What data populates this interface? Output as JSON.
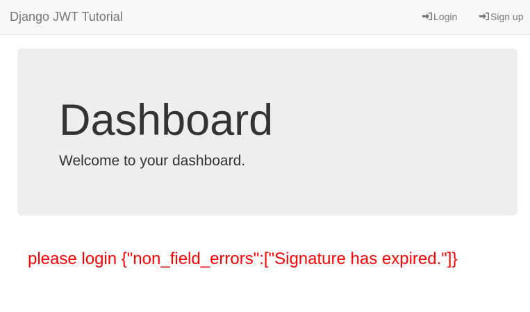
{
  "navbar": {
    "brand": "Django JWT Tutorial",
    "links": [
      {
        "label": "Login",
        "icon": "log-in-icon"
      },
      {
        "label": "Sign up",
        "icon": "log-in-icon"
      }
    ],
    "background": "#f8f8f8",
    "text_color": "#777777"
  },
  "jumbotron": {
    "title": "Dashboard",
    "lead": "Welcome to your dashboard.",
    "background": "#eeeeee"
  },
  "error": {
    "message": "please login {\"non_field_errors\":[\"Signature has expired.\"]}",
    "color": "#ff0000"
  }
}
